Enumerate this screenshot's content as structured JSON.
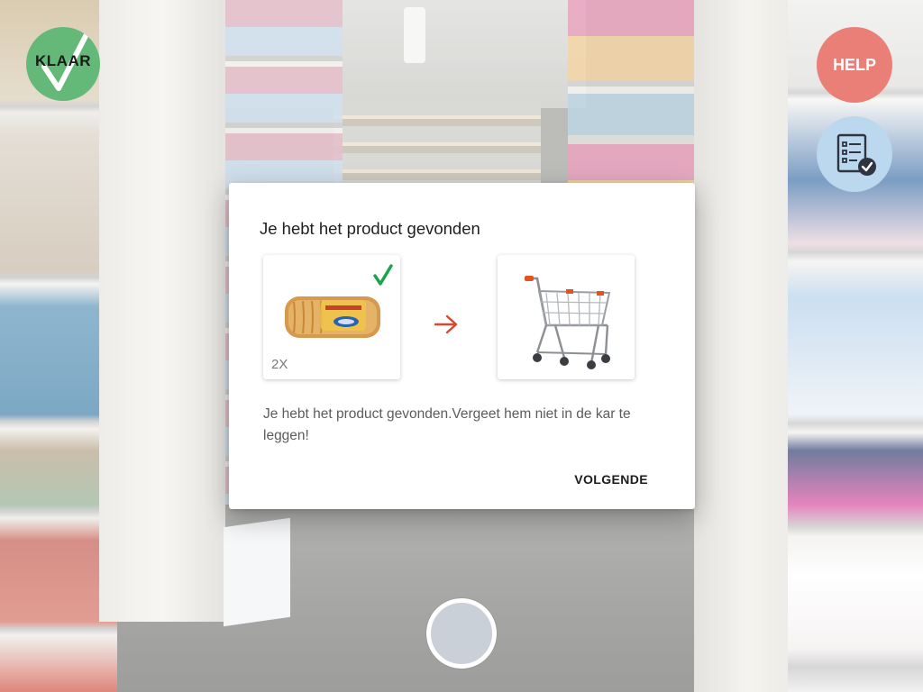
{
  "controls": {
    "done_label": "KLAAR",
    "help_label": "HELP"
  },
  "dialog": {
    "title": "Je hebt het product gevonden",
    "product": {
      "quantity": "2X",
      "icon": "bread-product-image",
      "found": true
    },
    "arrow_icon": "arrow-right-icon",
    "cart_icon": "shopping-cart-image",
    "message": "Je hebt het product gevonden.Vergeet hem niet in de kar te leggen!",
    "next_label": "VOLGENDE"
  },
  "colors": {
    "done_green": "#64b978",
    "help_red": "#e97f76",
    "list_blue": "#bcd8ee",
    "check_green": "#1aa34a",
    "arrow_red": "#d9472e"
  }
}
